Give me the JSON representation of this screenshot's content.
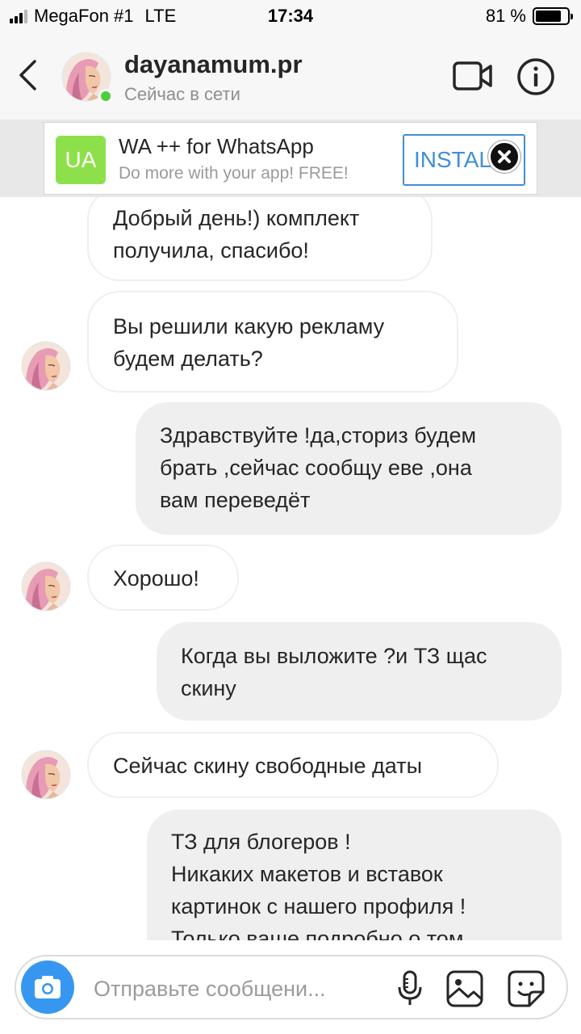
{
  "status_bar": {
    "carrier": "MegaFon #1",
    "network": "LTE",
    "time": "17:34",
    "battery": "81 %",
    "battery_level": 0.81
  },
  "header": {
    "username": "dayanamum.pr",
    "presence": "Сейчас в сети",
    "back_icon": "chevron-left-icon",
    "video_icon": "video-camera-icon",
    "info_icon": "info-icon"
  },
  "ad": {
    "icon_text": "UA",
    "title": "WA ++ for WhatsApp",
    "subtitle": "Do more with your app! FREE!",
    "button": "INSTALL",
    "close_icon": "close-icon"
  },
  "messages": [
    {
      "direction": "incoming",
      "text": "Добрый день!) комплект\nполучила, спасибо!",
      "show_avatar": false
    },
    {
      "direction": "incoming",
      "text": "Вы решили какую рекламу\nбудем делать?",
      "show_avatar": true
    },
    {
      "direction": "outgoing",
      "text": "Здравствуйте !да,сториз будем\nбрать ,сейчас сообщу еве ,она\nвам переведёт"
    },
    {
      "direction": "incoming",
      "text": "Хорошо!",
      "show_avatar": true
    },
    {
      "direction": "outgoing",
      "text": "Когда вы выложите ?и ТЗ щас\nскину"
    },
    {
      "direction": "incoming",
      "text": "Сейчас скину свободные даты",
      "show_avatar": true
    },
    {
      "direction": "outgoing",
      "text": "ТЗ для блогеров !\nНикаких макетов и вставок\nкартинок с нашего профиля !\nТолько ваше подробно о том"
    }
  ],
  "composer": {
    "placeholder": "Отправьте сообщени...",
    "camera_icon": "camera-icon",
    "mic_icon": "microphone-icon",
    "gallery_icon": "image-icon",
    "sticker_icon": "sticker-icon"
  },
  "colors": {
    "accent": "#3797f0",
    "online": "#4ccd3c",
    "ad_icon": "#8ee04b",
    "ad_button": "#3f8fd6",
    "outgoing_bubble": "#efefef"
  }
}
